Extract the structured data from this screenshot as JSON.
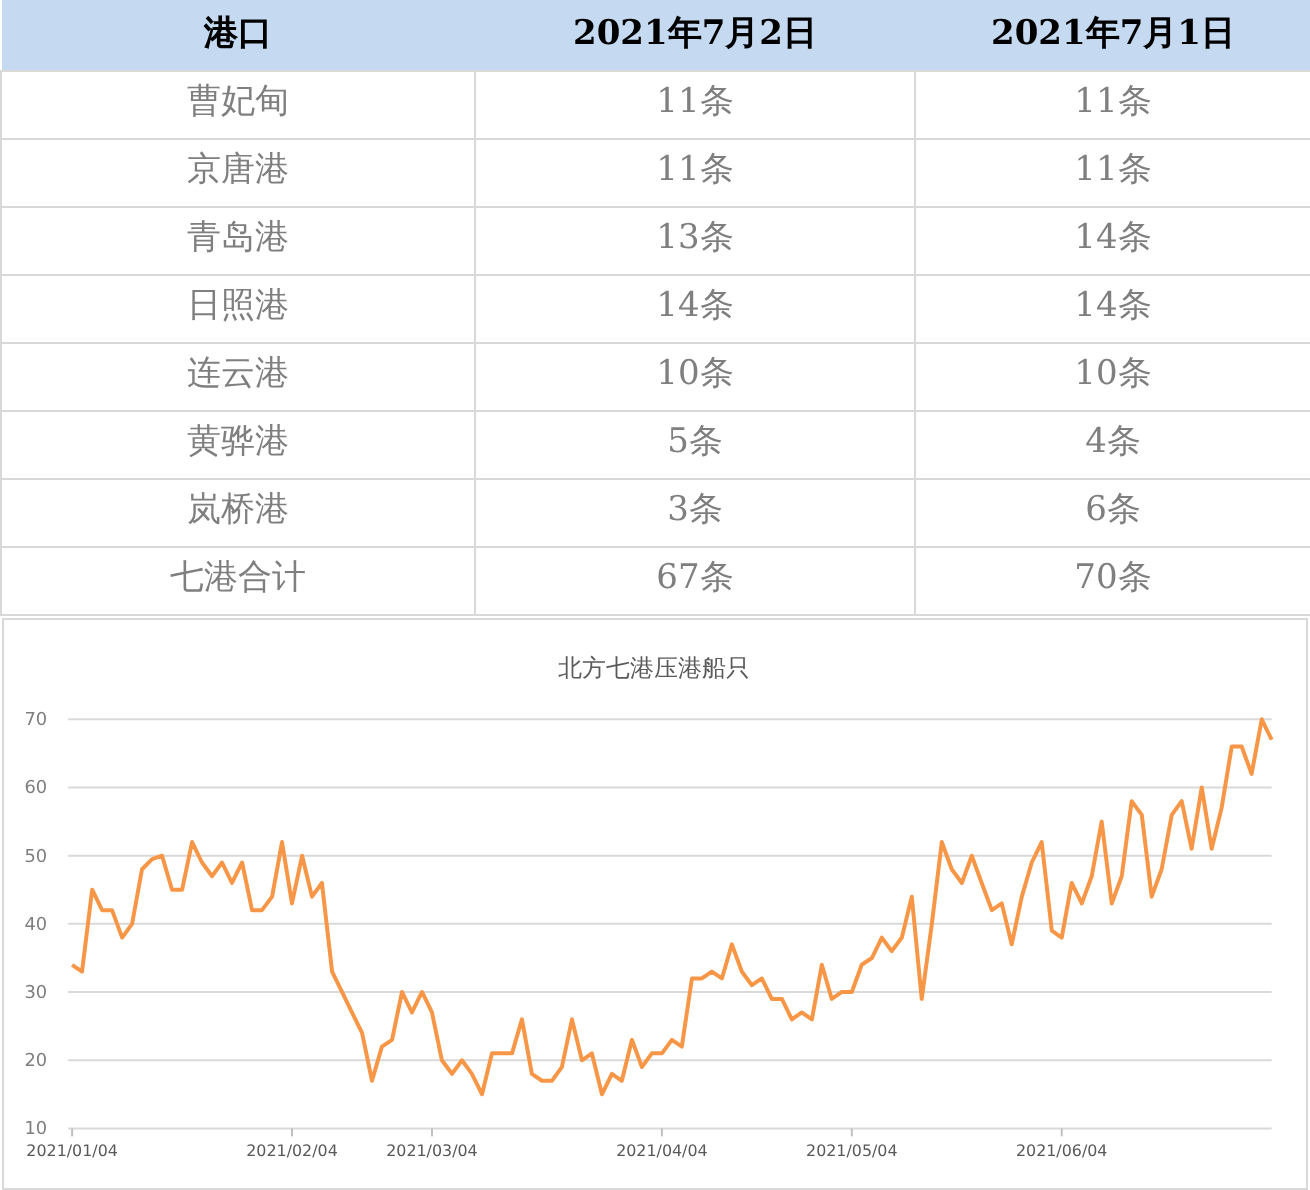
{
  "table": {
    "columns": [
      "港口",
      "2021年7月2日",
      "2021年7月1日"
    ],
    "rows": [
      [
        "曹妃甸",
        "11条",
        "11条"
      ],
      [
        "京唐港",
        "11条",
        "11条"
      ],
      [
        "青岛港",
        "13条",
        "14条"
      ],
      [
        "日照港",
        "14条",
        "14条"
      ],
      [
        "连云港",
        "10条",
        "10条"
      ],
      [
        "黄骅港",
        "5条",
        "4条"
      ],
      [
        "岚桥港",
        "3条",
        "6条"
      ],
      [
        "七港合计",
        "67条",
        "70条"
      ]
    ]
  },
  "chart": {
    "chart_data": {
      "type": "line",
      "title": "北方七港压港船只",
      "categories": [
        "2021/01/04",
        null,
        null,
        null,
        null,
        null,
        null,
        null,
        null,
        null,
        null,
        null,
        null,
        null,
        null,
        null,
        null,
        null,
        null,
        null,
        null,
        null,
        "2021/02/04",
        null,
        null,
        null,
        null,
        null,
        null,
        null,
        null,
        null,
        null,
        null,
        null,
        null,
        "2021/03/04",
        null,
        null,
        null,
        null,
        null,
        null,
        null,
        null,
        null,
        null,
        null,
        null,
        null,
        null,
        null,
        null,
        null,
        null,
        null,
        null,
        null,
        null,
        "2021/04/04",
        null,
        null,
        null,
        null,
        null,
        null,
        null,
        null,
        null,
        null,
        null,
        null,
        null,
        null,
        null,
        null,
        null,
        null,
        "2021/05/04",
        null,
        null,
        null,
        null,
        null,
        null,
        null,
        null,
        null,
        null,
        null,
        null,
        null,
        null,
        null,
        null,
        null,
        null,
        null,
        null,
        "2021/06/04",
        null,
        null,
        null,
        null,
        null,
        null,
        null,
        null,
        null,
        null,
        null,
        null,
        null,
        null,
        null,
        null,
        null,
        null,
        null,
        null,
        null
      ],
      "series": [
        {
          "color": "#f79646",
          "values": [
            34,
            33,
            45,
            42,
            42,
            38,
            40,
            48,
            49.5,
            50,
            45,
            45,
            52,
            49,
            47,
            49,
            46,
            49,
            42,
            42,
            44,
            52,
            43,
            50,
            44,
            46,
            33,
            30,
            27,
            24,
            17,
            22,
            23,
            30,
            27,
            30,
            27,
            20,
            18,
            20,
            18,
            15,
            21,
            21,
            21,
            26,
            18,
            17,
            17,
            19,
            26,
            20,
            21,
            15,
            18,
            17,
            23,
            19,
            21,
            21,
            23,
            22,
            32,
            32,
            33,
            32,
            37,
            33,
            31,
            32,
            29,
            29,
            26,
            27,
            26,
            34,
            29,
            30,
            30,
            34,
            35,
            38,
            36,
            38,
            44,
            29,
            40,
            52,
            48,
            46,
            50,
            46,
            42,
            43,
            37,
            44,
            49,
            52,
            39,
            38,
            46,
            43,
            47,
            55,
            43,
            47,
            58,
            56,
            44,
            48,
            56,
            58,
            51,
            60,
            51,
            57,
            66,
            66,
            62,
            70,
            67
          ]
        }
      ],
      "ylim": [
        10,
        70
      ],
      "yticks": [
        10,
        20,
        30,
        40,
        50,
        60,
        70
      ],
      "grid": true
    }
  }
}
